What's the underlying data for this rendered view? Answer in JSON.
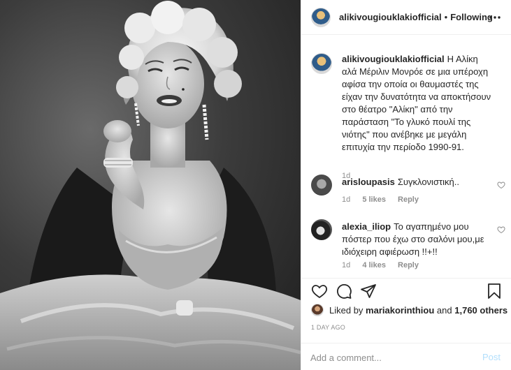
{
  "post": {
    "photo_icon": "vintage-portrait-photo"
  },
  "header": {
    "username": "alikivougiouklakiofficial",
    "separator": "•",
    "follow_status": "Following",
    "more_icon": "more-horizontal-icon"
  },
  "caption": {
    "username": "alikivougiouklakiofficial",
    "text": "Η Αλίκη αλά Μέριλιν Μονρόε σε μια υπέροχη αφίσα την οποία οι θαυμαστές της είχαν την δυνατότητα να αποκτήσουν στο θέατρο \"Αλίκη\" από την παράσταση \"Το γλυκό πουλί της νιότης\" που ανέβηκε με μεγάλη επιτυχία την περίοδο 1990-91.",
    "age": "1d"
  },
  "comments": [
    {
      "username": "arisloupasis",
      "text": "Συγκλονιστική..",
      "age": "1d",
      "likes": "5 likes",
      "reply": "Reply"
    },
    {
      "username": "alexia_iliop",
      "text": "Το αγαπημένο μου πόστερ που έχω στο σαλόνι μου,με ιδιόχειρη αφιέρωση !!+!!",
      "age": "1d",
      "likes": "4 likes",
      "reply": "Reply"
    }
  ],
  "actions": {
    "like_icon": "heart-icon",
    "comment_icon": "comment-icon",
    "share_icon": "share-icon",
    "save_icon": "bookmark-icon"
  },
  "likes": {
    "prefix": "Liked by",
    "user": "mariakorinthiou",
    "conjunction": "and",
    "others": "1,760 others"
  },
  "timestamp": "1 DAY AGO",
  "comment_box": {
    "placeholder": "Add a comment...",
    "post_label": "Post"
  }
}
